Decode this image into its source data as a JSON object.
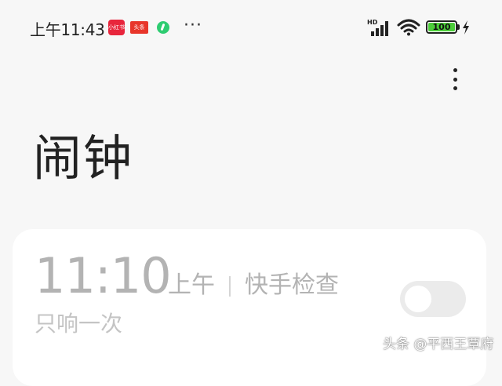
{
  "status_bar": {
    "time": "上午11:43",
    "app_icons": [
      {
        "name": "xiaohongshu-icon",
        "text": "小红书"
      },
      {
        "name": "toutiao-icon",
        "text": "头条"
      },
      {
        "name": "green-app-icon",
        "text": ""
      }
    ],
    "more_notifications": "···",
    "network": "HD",
    "battery_level": "100"
  },
  "header": {
    "menu_icon": "more-vertical-icon"
  },
  "page": {
    "title": "闹钟"
  },
  "alarms": [
    {
      "time": "11:10",
      "ampm": "上午",
      "label": "快手检查",
      "repeat": "只响一次",
      "enabled": false
    }
  ],
  "watermark": "头条 @平西王覃府",
  "colors": {
    "background": "#f7f7f7",
    "card": "#ffffff",
    "battery": "#4ccd3a",
    "disabled_text": "#b3b3b3"
  }
}
